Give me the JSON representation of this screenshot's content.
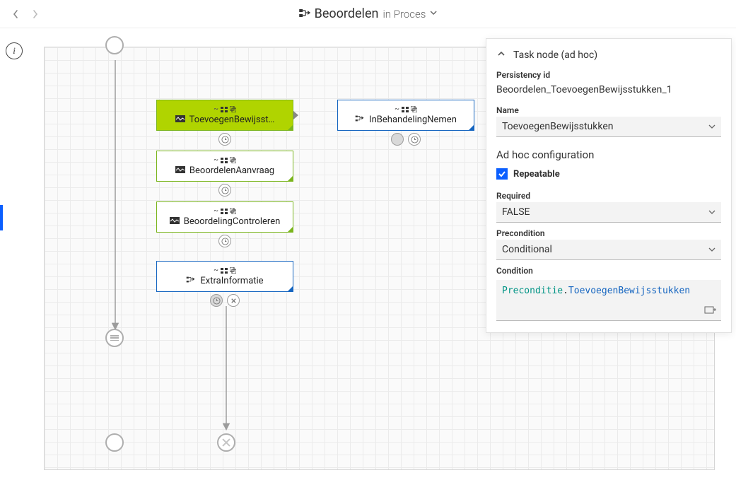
{
  "header": {
    "title_main": "Beoordelen",
    "title_sub": "in Proces"
  },
  "nodes": {
    "toevoegen": {
      "label": "ToevoegenBewijsst…"
    },
    "inbehandeling": {
      "label": "InBehandelingNemen"
    },
    "aanvraag": {
      "label": "BeoordelenAanvraag"
    },
    "controleren": {
      "label": "BeoordelingControleren"
    },
    "extra": {
      "label": "ExtraInformatie"
    }
  },
  "panel": {
    "title": "Task node (ad hoc)",
    "persistency_label": "Persistency id",
    "persistency_value": "Beoordelen_ToevoegenBewijsstukken_1",
    "name_label": "Name",
    "name_value": "ToevoegenBewijsstukken",
    "section": "Ad hoc configuration",
    "repeatable_label": "Repeatable",
    "required_label": "Required",
    "required_value": "FALSE",
    "precondition_label": "Precondition",
    "precondition_value": "Conditional",
    "condition_label": "Condition",
    "condition_a": "Preconditie",
    "condition_b": "ToevoegenBewijsstukken"
  }
}
